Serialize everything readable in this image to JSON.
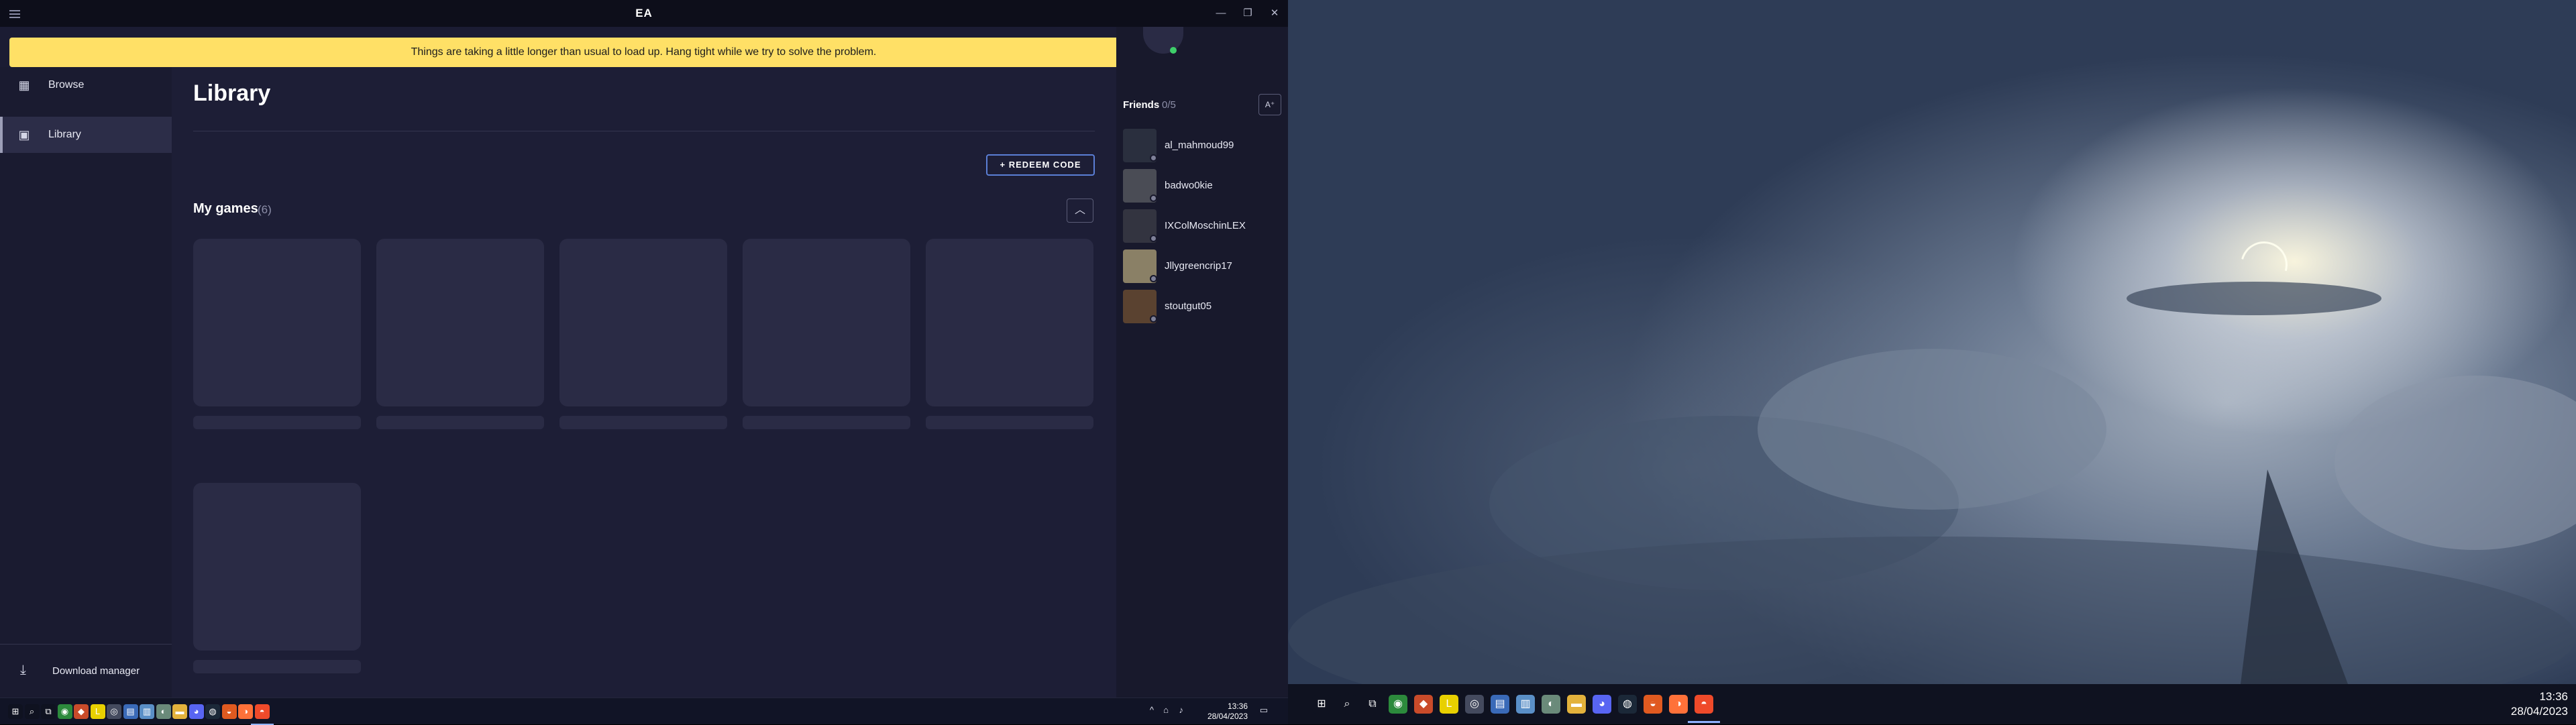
{
  "app": {
    "title": "EA"
  },
  "window_controls": {
    "minimize": "—",
    "maximize": "❐",
    "close": "✕"
  },
  "banner": {
    "message": "Things are taking a little longer than usual to load up. Hang tight while we try to solve the problem.",
    "close_glyph": "×"
  },
  "sidebar": {
    "items": [
      {
        "label": "Browse",
        "icon": "grid-icon",
        "glyph": "▦",
        "active": false
      },
      {
        "label": "Library",
        "icon": "library-icon",
        "glyph": "▣",
        "active": true
      }
    ],
    "download_manager": {
      "label": "Download manager",
      "icon": "download-icon",
      "glyph": "⤓"
    }
  },
  "library": {
    "title": "Library",
    "redeem_label": "+  REDEEM CODE",
    "my_games": {
      "title": "My games",
      "count": "(6)",
      "collapse_glyph": "︿"
    },
    "tiles_count": 6
  },
  "friends": {
    "title": "Friends",
    "count": "0/5",
    "add_glyph": "A⁺",
    "list": [
      {
        "name": "al_mahmoud99",
        "color": "#2a2f3e"
      },
      {
        "name": "badwo0kie",
        "color": "#4a4c55"
      },
      {
        "name": "IXColMoschinLEX",
        "color": "#333440"
      },
      {
        "name": "Jllygreencrip17",
        "color": "#8a8066"
      },
      {
        "name": "stoutgut05",
        "color": "#5a4230"
      }
    ]
  },
  "taskbar_left": {
    "clock_time": "13:36",
    "clock_date": "28/04/2023"
  },
  "taskbar_right": {
    "clock_time": "13:36",
    "clock_date": "28/04/2023",
    "icons": [
      {
        "name": "windows-start-icon",
        "glyph": "⊞",
        "color": "#0f1220"
      },
      {
        "name": "search-icon",
        "glyph": "⌕",
        "color": "#0f1220"
      },
      {
        "name": "task-view-icon",
        "glyph": "⧉",
        "color": "#0f1220"
      },
      {
        "name": "chrome-icon",
        "glyph": "◉",
        "color": "#2c8a3c"
      },
      {
        "name": "app-icon",
        "glyph": "◆",
        "color": "#c94b2a"
      },
      {
        "name": "live-icon",
        "glyph": "L",
        "color": "#e8d000"
      },
      {
        "name": "media-icon",
        "glyph": "◎",
        "color": "#444a5e"
      },
      {
        "name": "calculator-icon",
        "glyph": "▤",
        "color": "#3a6ab8"
      },
      {
        "name": "notes-icon",
        "glyph": "▥",
        "color": "#5a8fc7"
      },
      {
        "name": "app2-icon",
        "glyph": "◐",
        "color": "#6a8a7a"
      },
      {
        "name": "file-explorer-icon",
        "glyph": "▬",
        "color": "#e3b23c"
      },
      {
        "name": "discord-icon",
        "glyph": "◕",
        "color": "#5865f2"
      },
      {
        "name": "steam-icon",
        "glyph": "◍",
        "color": "#1b2838"
      },
      {
        "name": "ea-icon",
        "glyph": "◒",
        "color": "#e05a20"
      },
      {
        "name": "firefox-icon",
        "glyph": "◑",
        "color": "#ff7139"
      },
      {
        "name": "ea-app-icon",
        "glyph": "◓",
        "color": "#ef4a2a"
      }
    ]
  }
}
